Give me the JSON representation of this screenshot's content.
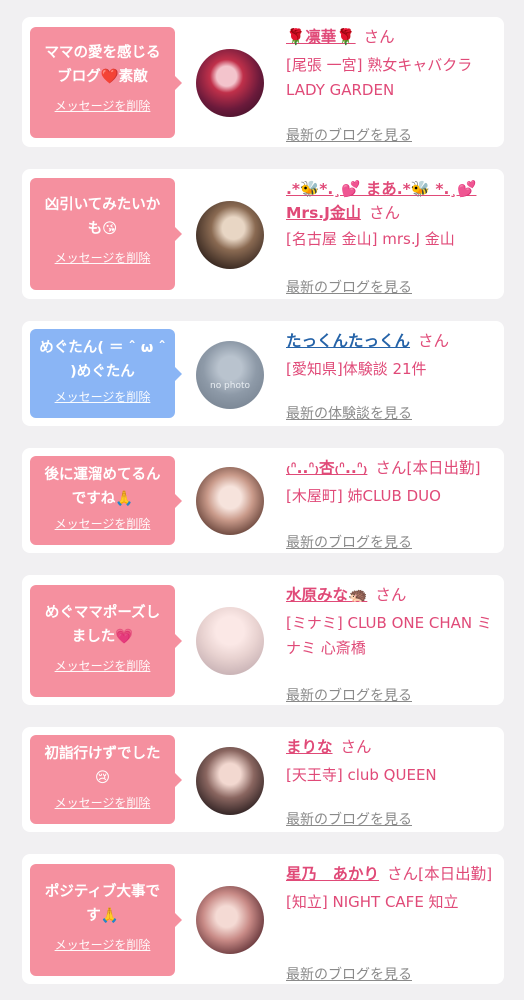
{
  "cards": [
    {
      "msg": "ママの愛を感じるブログ❤️素敵",
      "delete": "メッセージを削除",
      "name": "🌹凛華🌹",
      "san": "さん",
      "detail": "[尾張 一宮] 熟女キャバクラ LADY GARDEN",
      "link": "最新のブログを見る"
    },
    {
      "msg": "凶引いてみたいかも😘",
      "delete": "メッセージを削除",
      "name": ".*🐝*.¸💕 まあ.*🐝 *.¸💕Mrs.J金山",
      "san": "さん",
      "detail": "[名古屋 金山] mrs.J 金山",
      "link": "最新のブログを見る"
    },
    {
      "msg": "めぐたん( ＝ ˆ ω ˆ )めぐたん",
      "delete": "メッセージを削除",
      "name": "たっくんたっくん",
      "san": "さん",
      "detail": "[愛知県]体験談 21件",
      "link": "最新の体験談を見る",
      "avatar_text": "no photo"
    },
    {
      "msg": "後に運溜めてるんですね🙏",
      "delete": "メッセージを削除",
      "name": "₍ᐢ..ᐢ₎杏₍ᐢ..ᐢ₎",
      "san": "さん[本日出勤]",
      "detail": "[木屋町] 姉CLUB DUO",
      "link": "最新のブログを見る"
    },
    {
      "msg": "めぐママポーズしました💗",
      "delete": "メッセージを削除",
      "name": "水原みな🦔",
      "san": "さん",
      "detail": "[ミナミ] CLUB ONE CHAN ミナミ 心斎橋",
      "link": "最新のブログを見る"
    },
    {
      "msg": "初詣行けずでした😢",
      "delete": "メッセージを削除",
      "name": "まりな",
      "san": "さん",
      "detail": "[天王寺] club QUEEN",
      "link": "最新のブログを見る"
    },
    {
      "msg": "ポジティブ大事です🙏",
      "delete": "メッセージを削除",
      "name": "星乃　あかり",
      "san": "さん[本日出勤]",
      "detail": "[知立] NIGHT CAFE 知立",
      "link": "最新のブログを見る"
    }
  ],
  "colors": {
    "pink": "#f5909f",
    "blue": "#8ab5f5",
    "name": "#e04a78",
    "link": "#8a8a8a"
  }
}
